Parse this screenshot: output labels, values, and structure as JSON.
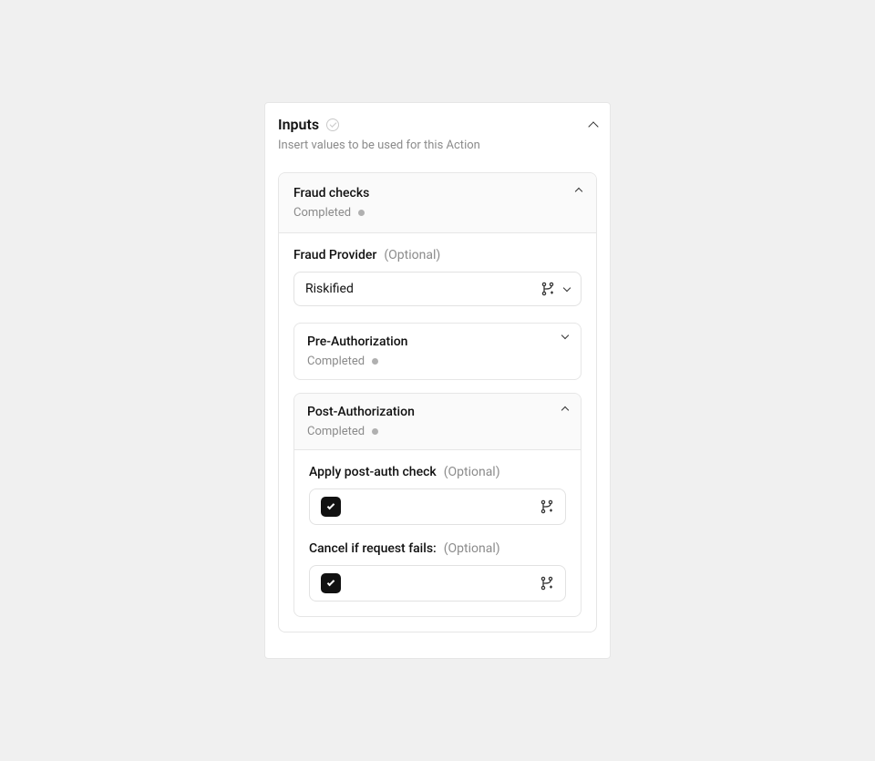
{
  "panel": {
    "title": "Inputs",
    "subtitle": "Insert values to be used for this Action"
  },
  "section_fraud": {
    "title": "Fraud checks",
    "status": "Completed"
  },
  "field_provider": {
    "label": "Fraud Provider",
    "optional": "(Optional)",
    "value": "Riskified"
  },
  "section_preauth": {
    "title": "Pre-Authorization",
    "status": "Completed"
  },
  "section_postauth": {
    "title": "Post-Authorization",
    "status": "Completed"
  },
  "field_apply_post": {
    "label": "Apply post-auth check",
    "optional": "(Optional)",
    "checked": true
  },
  "field_cancel_fail": {
    "label": "Cancel if request fails:",
    "optional": "(Optional)",
    "checked": true
  }
}
